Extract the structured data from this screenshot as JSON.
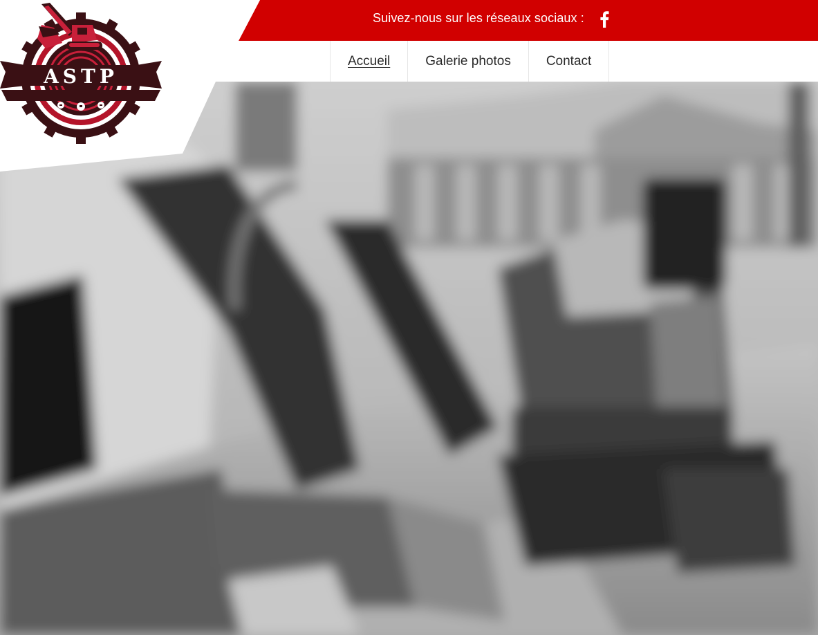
{
  "brand": {
    "logo_text": "ASTP",
    "primary_color": "#d10000",
    "dark_color": "#3a1014"
  },
  "social": {
    "label": "Suivez-nous sur les réseaux sociaux :",
    "icon": "facebook-icon"
  },
  "nav": {
    "items": [
      {
        "label": "Accueil",
        "active": true
      },
      {
        "label": "Galerie photos",
        "active": false
      },
      {
        "label": "Contact",
        "active": false
      }
    ]
  },
  "hero": {
    "subject": "mini excavator on construction site",
    "filter": "blurred grayscale"
  }
}
